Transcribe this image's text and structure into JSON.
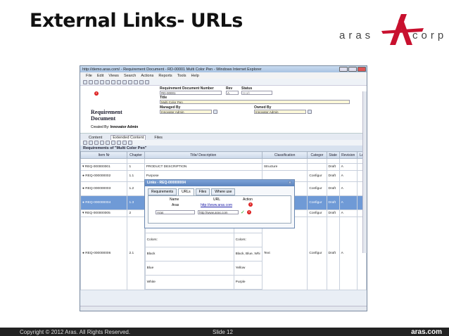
{
  "slide": {
    "title": "External Links- URLs",
    "logo_text": "aras",
    "logo_text2": "corp",
    "copyright": "Copyright © 2012 Aras.  All Rights Reserved.",
    "slide_num": "Slide 12",
    "brand": "aras.com"
  },
  "window": {
    "title": "http://demo.aras.com/ - Requirement Document - RD-00001 Multi Color Pen - Windows Internet Explorer",
    "menu": [
      "File",
      "Edit",
      "Views",
      "Search",
      "Actions",
      "Reports",
      "Tools",
      "Help"
    ]
  },
  "form": {
    "doc_number_label": "Requirement Document Number",
    "doc_number": "RD-00001",
    "rev_label": "Rev",
    "rev": "A",
    "status_label": "Status",
    "status": "Draft",
    "title_label": "Title",
    "title": "Multi Color Pen",
    "managed_label": "Managed By",
    "managed": "Innovator Admin",
    "owned_label": "Owned By",
    "owned": "Innovator Admin",
    "heading1": "Requirement",
    "heading2": "Document",
    "created_label": "Created By:",
    "created": "Innovator Admin"
  },
  "tabs": [
    "Content",
    "Extended Content",
    "Files"
  ],
  "grid": {
    "title": "Requirements of \"Multi Color Pen\"",
    "columns": [
      "Item Nr",
      "Chapter",
      "Title/ Description",
      "Classification",
      "Categor",
      "State",
      "Revision",
      "Le"
    ],
    "rows": [
      {
        "item": "▾ REQ-000000001",
        "chapter": "1",
        "title": "PRODUCT DESCRIPTION",
        "class": "Structure",
        "cat": "",
        "state": "Draft",
        "rev": "A"
      },
      {
        "item": "● REQ-000000002",
        "chapter": "1.1",
        "title": "Purpose",
        "class": "",
        "cat": "Configur",
        "state": "Draft",
        "rev": "A"
      },
      {
        "item": "● REQ-000000003",
        "chapter": "1.2",
        "title": "",
        "class": "",
        "cat": "Configur",
        "state": "Draft",
        "rev": "A"
      },
      {
        "item": "● REQ-000000004",
        "chapter": "1.3",
        "title": "",
        "class": "",
        "cat": "Configur",
        "state": "Draft",
        "rev": "A"
      },
      {
        "item": "▾ REQ-000000005",
        "chapter": "2",
        "title": "",
        "class": "",
        "cat": "Configur",
        "state": "Draft",
        "rev": "A"
      },
      {
        "item": "● REQ-000000006",
        "chapter": "2.1",
        "title": "",
        "class": "Text",
        "cat": "Configur",
        "state": "Draft",
        "rev": "A"
      }
    ],
    "inner": [
      [
        "Type: Adult Use ,  Overall Length: 200 mm",
        "Type: Children a"
      ],
      [
        "Colors:",
        "Colors:"
      ],
      [
        "Black",
        "Black, Blue, Whi"
      ],
      [
        "Blue",
        "Yellow"
      ],
      [
        "White",
        "Purple"
      ]
    ]
  },
  "dialog": {
    "title": "Links - REQ-000000004",
    "tabs": [
      "Requirements",
      "URLs",
      "Files",
      "Where use"
    ],
    "col_name": "Name",
    "col_url": "URL",
    "col_action": "Action",
    "rows": [
      {
        "name": "Aras",
        "url": "http://www.aras.com"
      },
      {
        "name": "Aras",
        "url": "http://www.aras.com"
      }
    ]
  }
}
